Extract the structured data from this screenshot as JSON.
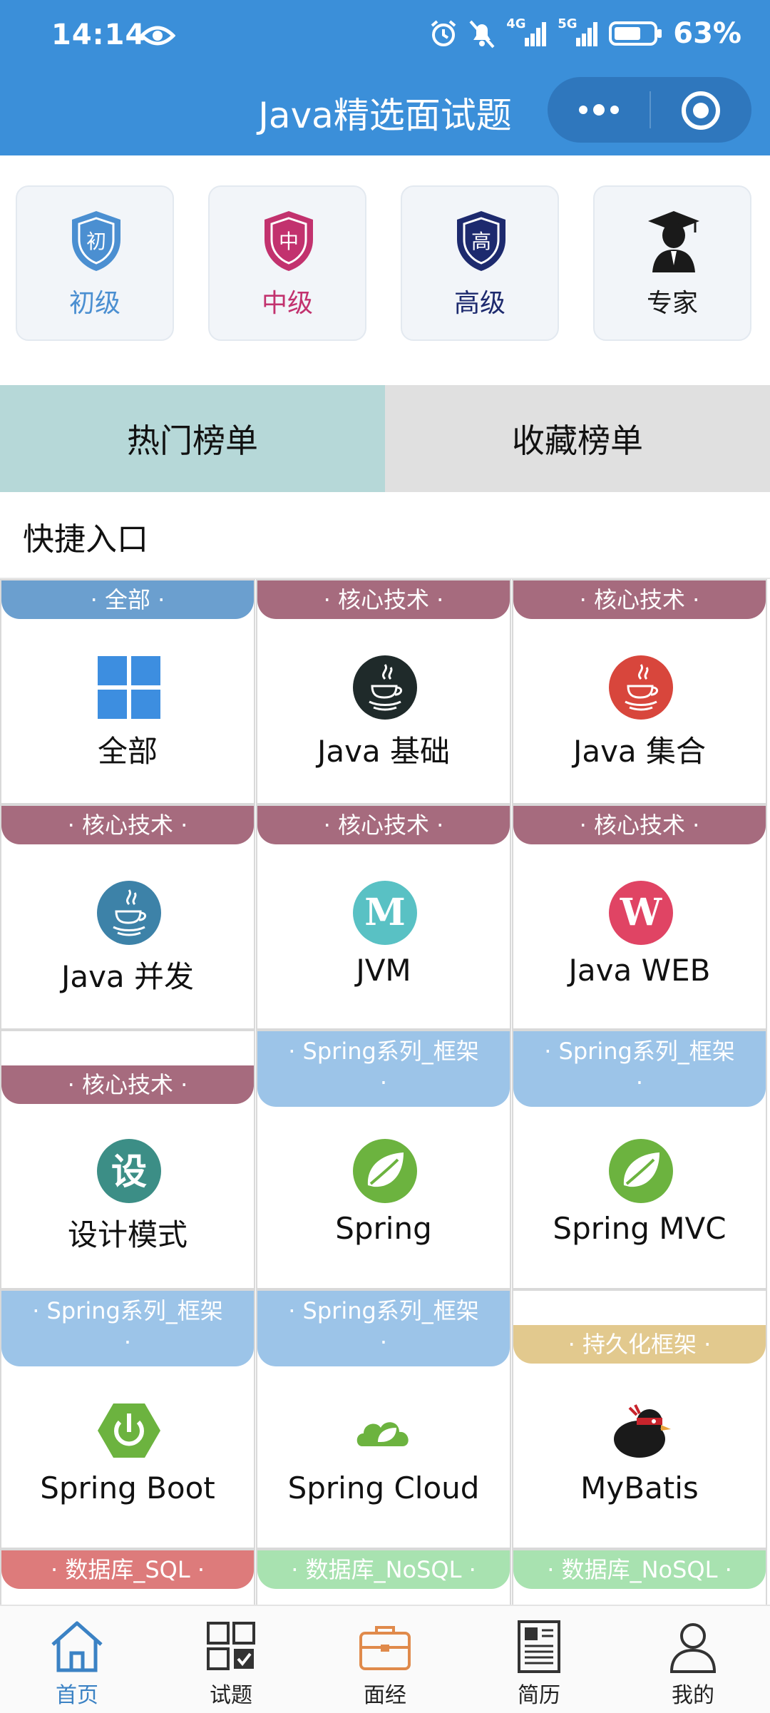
{
  "status_bar": {
    "time": "14:14",
    "network_4g": "4G",
    "network_5g": "5G",
    "battery": "63%"
  },
  "title_bar": {
    "title": "Java精选面试题"
  },
  "levels": [
    {
      "label": "初级",
      "badge_char": "初",
      "color": "#4b8fd1",
      "icon": "shield-icon"
    },
    {
      "label": "中级",
      "badge_char": "中",
      "color": "#c2326e",
      "icon": "shield-icon"
    },
    {
      "label": "高级",
      "badge_char": "高",
      "color": "#1d2a6e",
      "icon": "shield-icon"
    },
    {
      "label": "专家",
      "color": "#1a1a1a",
      "icon": "graduate-icon"
    }
  ],
  "rank_tabs": {
    "hot": "热门榜单",
    "fav": "收藏榜单",
    "active": "hot"
  },
  "section_title": "快捷入口",
  "categories": [
    {
      "tag": "· 全部 ·",
      "label": "全部",
      "tag_color": "#6b9fcf",
      "icon": "windows-grid-icon"
    },
    {
      "tag": "· 核心技术 ·",
      "label": "Java 基础",
      "tag_color": "#a66b7e",
      "icon": "java-icon"
    },
    {
      "tag": "· 核心技术 ·",
      "label": "Java 集合",
      "tag_color": "#a66b7e",
      "icon": "java-icon"
    },
    {
      "tag": "· 核心技术 ·",
      "label": "Java 并发",
      "tag_color": "#a66b7e",
      "icon": "java-icon"
    },
    {
      "tag": "· 核心技术 ·",
      "label": "JVM",
      "tag_color": "#a66b7e",
      "icon": "letter-m-icon",
      "letter": "M"
    },
    {
      "tag": "· 核心技术 ·",
      "label": "Java WEB",
      "tag_color": "#a66b7e",
      "icon": "letter-w-icon",
      "letter": "W"
    },
    {
      "tag": "· 核心技术 ·",
      "label": "设计模式",
      "tag_color": "#a66b7e",
      "icon": "letter-she-icon",
      "letter": "设"
    },
    {
      "tag_line1": "· Spring系列_框架",
      "tag_line2": "·",
      "label": "Spring",
      "tag_color": "#9cc4e8",
      "icon": "spring-leaf-icon"
    },
    {
      "tag_line1": "· Spring系列_框架",
      "tag_line2": "·",
      "label": "Spring MVC",
      "tag_color": "#9cc4e8",
      "icon": "spring-leaf-icon"
    },
    {
      "tag_line1": "· Spring系列_框架",
      "tag_line2": "·",
      "label": "Spring Boot",
      "tag_color": "#9cc4e8",
      "icon": "spring-boot-icon"
    },
    {
      "tag_line1": "· Spring系列_框架",
      "tag_line2": "·",
      "label": "Spring Cloud",
      "tag_color": "#9cc4e8",
      "icon": "spring-cloud-icon"
    },
    {
      "tag": "· 持久化框架 ·",
      "label": "MyBatis",
      "tag_color": "#e2c98e",
      "icon": "mybatis-bird-icon"
    },
    {
      "tag": "· 数据库_SQL ·",
      "tag_color": "#dd7b7b"
    },
    {
      "tag": "· 数据库_NoSQL ·",
      "tag_color": "#a8e2b0"
    },
    {
      "tag": "· 数据库_NoSQL ·",
      "tag_color": "#a8e2b0"
    }
  ],
  "bottom_nav": [
    {
      "label": "首页",
      "icon": "home-icon",
      "active": true
    },
    {
      "label": "试题",
      "icon": "grid-check-icon",
      "active": false
    },
    {
      "label": "面经",
      "icon": "briefcase-icon",
      "active": false
    },
    {
      "label": "简历",
      "icon": "resume-icon",
      "active": false
    },
    {
      "label": "我的",
      "icon": "user-icon",
      "active": false
    }
  ]
}
